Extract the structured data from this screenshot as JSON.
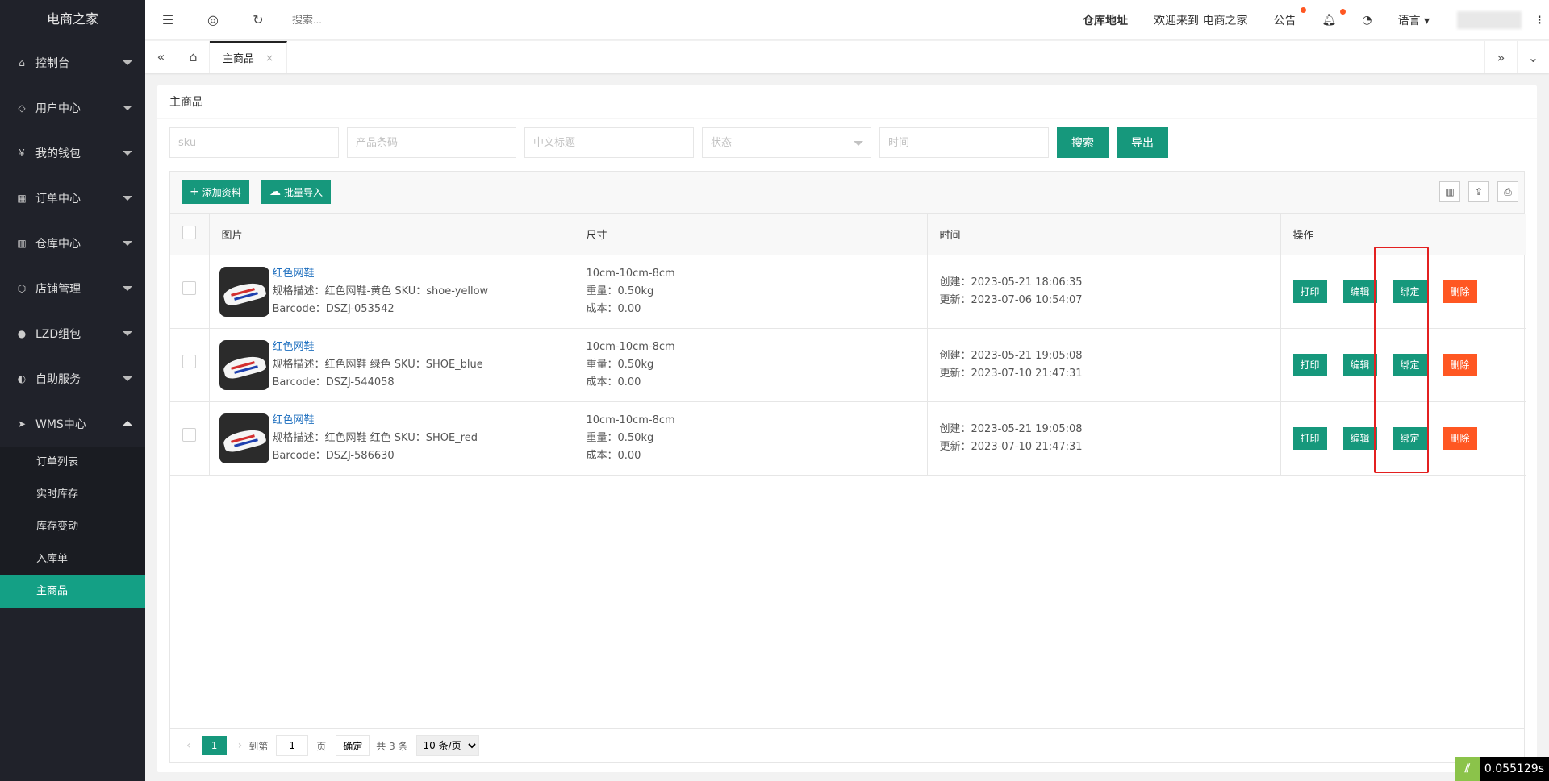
{
  "app": {
    "title": "电商之家"
  },
  "sidebar": {
    "items": [
      {
        "label": "控制台",
        "icon": "home-icon"
      },
      {
        "label": "用户中心",
        "icon": "diamond-icon"
      },
      {
        "label": "我的钱包",
        "icon": "wallet-icon"
      },
      {
        "label": "订单中心",
        "icon": "order-icon"
      },
      {
        "label": "仓库中心",
        "icon": "warehouse-icon"
      },
      {
        "label": "店铺管理",
        "icon": "store-icon"
      },
      {
        "label": "LZD组包",
        "icon": "package-icon"
      },
      {
        "label": "自助服务",
        "icon": "service-icon"
      },
      {
        "label": "WMS中心",
        "icon": "send-icon"
      }
    ],
    "wms_sub": [
      {
        "label": "订单列表"
      },
      {
        "label": "实时库存"
      },
      {
        "label": "库存变动"
      },
      {
        "label": "入库单"
      },
      {
        "label": "主商品",
        "active": true
      }
    ]
  },
  "topbar": {
    "search_placeholder": "搜索...",
    "warehouse": "仓库地址",
    "welcome": "欢迎来到 电商之家",
    "notice": "公告",
    "language": "语言",
    "more": "⋮"
  },
  "tabs": {
    "active": "主商品",
    "close": "×"
  },
  "page": {
    "title": "主商品"
  },
  "filters": {
    "sku_placeholder": "sku",
    "barcode_placeholder": "产品条码",
    "cn_title_placeholder": "中文标题",
    "status_placeholder": "状态",
    "time_placeholder": "时间",
    "search_label": "搜索",
    "export_label": "导出"
  },
  "toolbar": {
    "add_label": "添加资料",
    "import_label": "批量导入"
  },
  "table": {
    "headers": {
      "image": "图片",
      "size": "尺寸",
      "time": "时间",
      "ops": "操作"
    },
    "rows": [
      {
        "name": "红色网鞋",
        "spec": "规格描述：红色网鞋-黄色  SKU：shoe-yellow",
        "barcode": "Barcode：DSZJ-053542",
        "dims": "10cm-10cm-8cm",
        "weight": "重量：0.50kg",
        "cost": "成本：0.00",
        "created": "创建：2023-05-21 18:06:35",
        "updated": "更新：2023-07-06 10:54:07"
      },
      {
        "name": "红色网鞋",
        "spec": "规格描述：红色网鞋 绿色  SKU：SHOE_blue",
        "barcode": "Barcode：DSZJ-544058",
        "dims": "10cm-10cm-8cm",
        "weight": "重量：0.50kg",
        "cost": "成本：0.00",
        "created": "创建：2023-05-21 19:05:08",
        "updated": "更新：2023-07-10 21:47:31"
      },
      {
        "name": "红色网鞋",
        "spec": "规格描述：红色网鞋 红色  SKU：SHOE_red",
        "barcode": "Barcode：DSZJ-586630",
        "dims": "10cm-10cm-8cm",
        "weight": "重量：0.50kg",
        "cost": "成本：0.00",
        "created": "创建：2023-05-21 19:05:08",
        "updated": "更新：2023-07-10 21:47:31"
      }
    ],
    "ops": {
      "print": "打印",
      "edit": "编辑",
      "bind": "绑定",
      "delete": "删除"
    }
  },
  "pagination": {
    "current": "1",
    "goto_label": "到第",
    "goto_value": "1",
    "page_unit": "页",
    "confirm": "确定",
    "total": "共 3 条",
    "per_page": "10 条/页"
  },
  "timer": "0.055129s",
  "colors": {
    "accent": "#16987c",
    "danger": "#ff5722",
    "sidebar": "#20222a",
    "highlight": "#e32020"
  }
}
